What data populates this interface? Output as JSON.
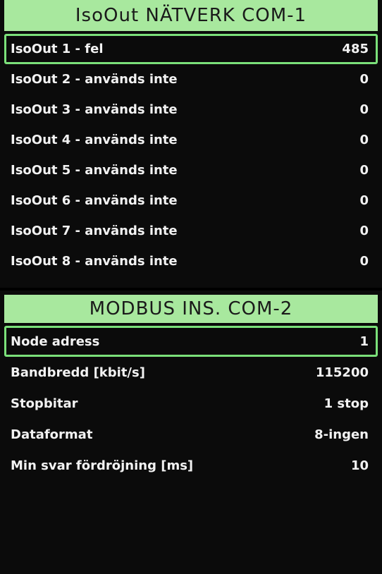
{
  "top_screen": {
    "title": "IsoOut NÄTVERK COM-1",
    "rows": [
      {
        "label": "IsoOut 1 - fel",
        "value": "485",
        "selected": true
      },
      {
        "label": "IsoOut 2 - används inte",
        "value": "0",
        "selected": false
      },
      {
        "label": "IsoOut 3 - används inte",
        "value": "0",
        "selected": false
      },
      {
        "label": "IsoOut 4 - används inte",
        "value": "0",
        "selected": false
      },
      {
        "label": "IsoOut 5 - används inte",
        "value": "0",
        "selected": false
      },
      {
        "label": "IsoOut 6 - används inte",
        "value": "0",
        "selected": false
      },
      {
        "label": "IsoOut 7 - används inte",
        "value": "0",
        "selected": false
      },
      {
        "label": "IsoOut 8 - används inte",
        "value": "0",
        "selected": false
      }
    ]
  },
  "bottom_screen": {
    "title": "MODBUS INS. COM-2",
    "rows": [
      {
        "label": "Node adress",
        "value": "1",
        "selected": true
      },
      {
        "label": "Bandbredd [kbit/s]",
        "value": "115200",
        "selected": false
      },
      {
        "label": "Stopbitar",
        "value": "1 stop",
        "selected": false
      },
      {
        "label": "Dataformat",
        "value": "8-ingen",
        "selected": false
      },
      {
        "label": "Min svar fördröjning [ms]",
        "value": "10",
        "selected": false
      }
    ]
  },
  "colors": {
    "title_bar": "#a8e89e",
    "selection_border": "#7be07a",
    "background": "#0b0b0b",
    "text": "#f2f2f2"
  }
}
